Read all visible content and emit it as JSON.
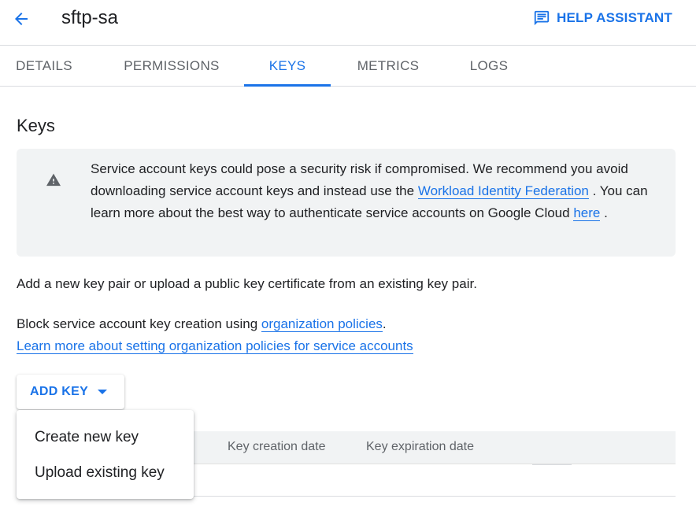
{
  "header": {
    "back_icon": "arrow-back-icon",
    "title": "sftp-sa",
    "help_icon": "feedback-chat-icon",
    "help_label": "HELP ASSISTANT"
  },
  "tabs": [
    {
      "label": "DETAILS",
      "active": false
    },
    {
      "label": "PERMISSIONS",
      "active": false
    },
    {
      "label": "KEYS",
      "active": true
    },
    {
      "label": "METRICS",
      "active": false
    },
    {
      "label": "LOGS",
      "active": false
    }
  ],
  "keys_section": {
    "title": "Keys",
    "warning": {
      "icon": "warning-icon",
      "text_1": "Service account keys could pose a security risk if compromised. We recommend you avoid downloading service account keys and instead use the ",
      "link_1": "Workload Identity Federation",
      "text_2": " . You can learn more about the best way to authenticate service accounts on Google Cloud ",
      "link_2": "here",
      "text_3": " ."
    },
    "intro": "Add a new key pair or upload a public key certificate from an existing key pair.",
    "block_text": "Block service account key creation using ",
    "block_link": "organization policies",
    "block_end": ".",
    "learn_more_link": "Learn more about setting organization policies for service accounts",
    "add_key_label": "ADD KEY",
    "table": {
      "columns": [
        "Key creation date",
        "Key expiration date"
      ]
    },
    "menu": {
      "items": [
        "Create new key",
        "Upload existing key"
      ]
    }
  },
  "colors": {
    "accent": "#1a73e8",
    "text": "#202124",
    "muted": "#5f6368",
    "warning_bg": "#f1f3f4"
  }
}
